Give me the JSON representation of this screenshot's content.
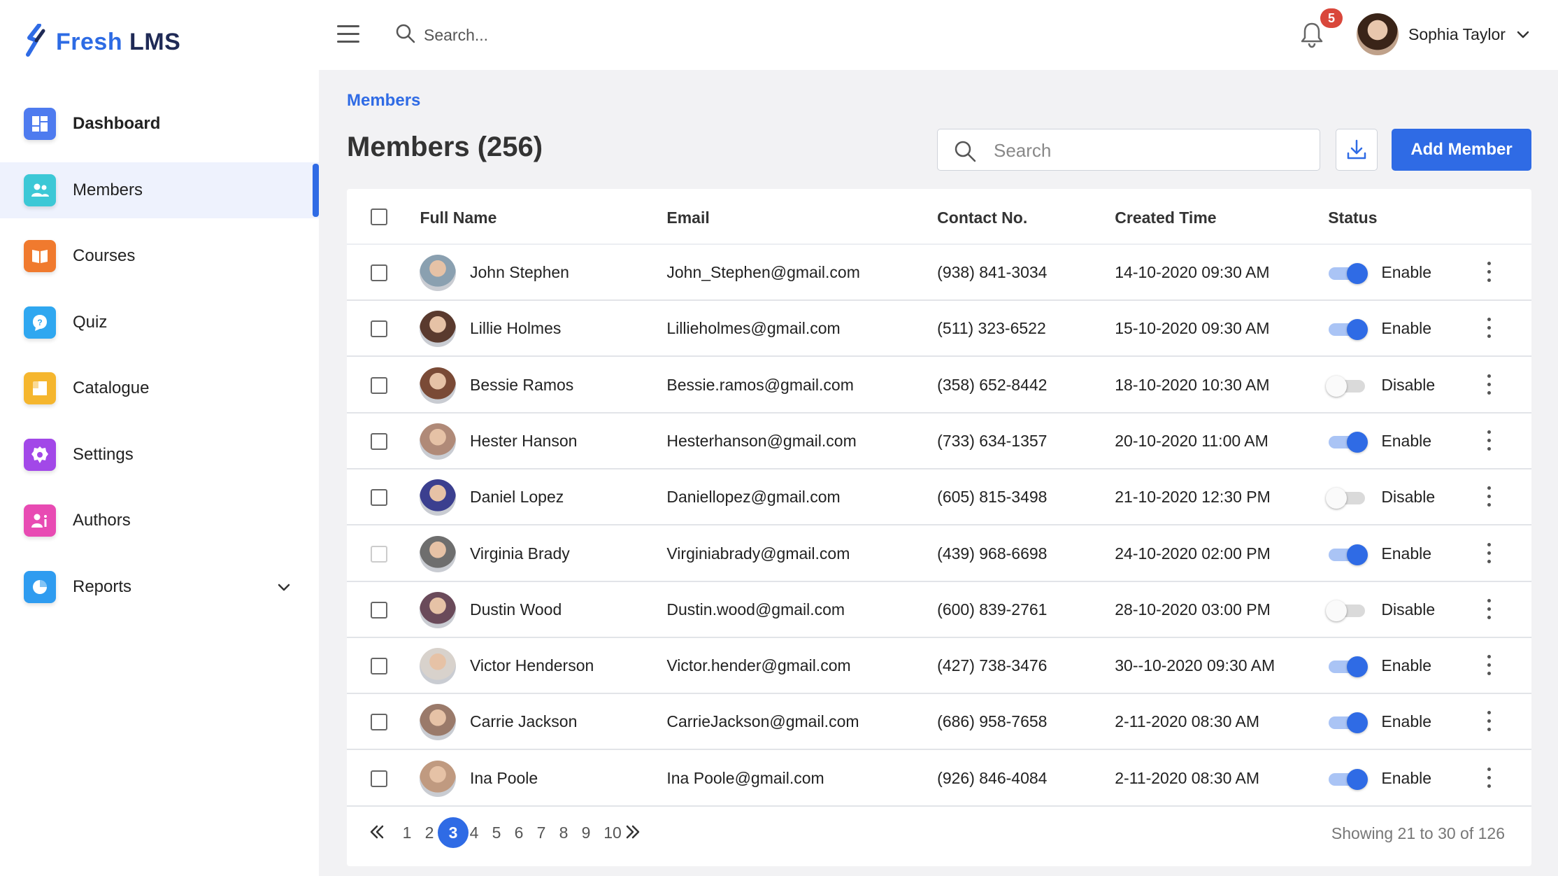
{
  "app": {
    "logo_fresh": "Fresh",
    "logo_lms": "LMS",
    "brand_color": "#2F6BE5"
  },
  "sidebar": {
    "items": [
      {
        "label": "Dashboard",
        "icon": "dashboard-icon",
        "color": "#4E7BEF"
      },
      {
        "label": "Members",
        "icon": "members-icon",
        "color": "#3CC8D6"
      },
      {
        "label": "Courses",
        "icon": "courses-icon",
        "color": "#F07A2E"
      },
      {
        "label": "Quiz",
        "icon": "quiz-icon",
        "color": "#2FA7F0"
      },
      {
        "label": "Catalogue",
        "icon": "catalogue-icon",
        "color": "#F5B62E"
      },
      {
        "label": "Settings",
        "icon": "settings-icon",
        "color": "#A248E8"
      },
      {
        "label": "Authors",
        "icon": "authors-icon",
        "color": "#E84BB3"
      },
      {
        "label": "Reports",
        "icon": "reports-icon",
        "color": "#2F9CF0"
      }
    ]
  },
  "topbar": {
    "search_placeholder": "Search...",
    "notification_count": "5",
    "user_name": "Sophia Taylor"
  },
  "main": {
    "breadcrumb": "Members",
    "title": "Members (256)",
    "search_placeholder": "Search",
    "add_button": "Add Member"
  },
  "table": {
    "headers": {
      "name": "Full Name",
      "email": "Email",
      "contact": "Contact No.",
      "created": "Created Time",
      "status": "Status"
    },
    "rows": [
      {
        "name": "John Stephen",
        "email": "John_Stephen@gmail.com",
        "contact": "(938) 841-3034",
        "created": "14-10-2020 09:30 AM",
        "status": "Enable",
        "enabled": true,
        "avatar_color": "#8aa0b0"
      },
      {
        "name": "Lillie Holmes",
        "email": "Lillieholmes@gmail.com",
        "contact": "(511) 323-6522",
        "created": "15-10-2020 09:30 AM",
        "status": "Enable",
        "enabled": true,
        "avatar_color": "#5a3a2e"
      },
      {
        "name": "Bessie Ramos",
        "email": "Bessie.ramos@gmail.com",
        "contact": "(358) 652-8442",
        "created": "18-10-2020 10:30 AM",
        "status": "Disable",
        "enabled": false,
        "avatar_color": "#7a4a36"
      },
      {
        "name": "Hester Hanson",
        "email": "Hesterhanson@gmail.com",
        "contact": "(733) 634-1357",
        "created": "20-10-2020 11:00 AM",
        "status": "Enable",
        "enabled": true,
        "avatar_color": "#b08a78"
      },
      {
        "name": "Daniel Lopez",
        "email": "Daniellopez@gmail.com",
        "contact": "(605) 815-3498",
        "created": "21-10-2020 12:30 PM",
        "status": "Disable",
        "enabled": false,
        "avatar_color": "#3b3f8f"
      },
      {
        "name": "Virginia Brady",
        "email": "Virginiabrady@gmail.com",
        "contact": "(439) 968-6698",
        "created": "24-10-2020 02:00 PM",
        "status": "Enable",
        "enabled": true,
        "avatar_color": "#6e6e6e"
      },
      {
        "name": "Dustin Wood",
        "email": "Dustin.wood@gmail.com",
        "contact": "(600) 839-2761",
        "created": "28-10-2020 03:00 PM",
        "status": "Disable",
        "enabled": false,
        "avatar_color": "#6a4a5a"
      },
      {
        "name": "Victor Henderson",
        "email": "Victor.hender@gmail.com",
        "contact": "(427) 738-3476",
        "created": "30--10-2020 09:30 AM",
        "status": "Enable",
        "enabled": true,
        "avatar_color": "#d8d2cc"
      },
      {
        "name": "Carrie Jackson",
        "email": "CarrieJackson@gmail.com",
        "contact": "(686) 958-7658",
        "created": "2-11-2020 08:30 AM",
        "status": "Enable",
        "enabled": true,
        "avatar_color": "#9a7a6a"
      },
      {
        "name": "Ina Poole",
        "email": "Ina Poole@gmail.com",
        "contact": "(926) 846-4084",
        "created": "2-11-2020 08:30 AM",
        "status": "Enable",
        "enabled": true,
        "avatar_color": "#c09a80"
      }
    ]
  },
  "pagination": {
    "pages": [
      "1",
      "2",
      "3",
      "4",
      "5",
      "6",
      "7",
      "8",
      "9",
      "10"
    ],
    "current": "3",
    "showing": "Showing 21 to 30 of 126"
  }
}
